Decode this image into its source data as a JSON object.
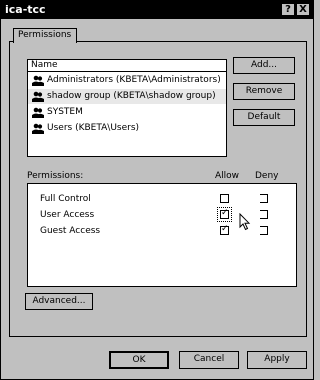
{
  "window": {
    "title": "ica-tcc",
    "help_glyph": "?",
    "close_glyph": "X"
  },
  "tabs": [
    {
      "label": "Permissions"
    }
  ],
  "accounts": {
    "header": "Name",
    "items": [
      {
        "label": "Administrators (KBETA\\Administrators)",
        "icon": "group-icon"
      },
      {
        "label": "shadow group (KBETA\\shadow group)",
        "icon": "group-icon",
        "selected": true
      },
      {
        "label": "SYSTEM",
        "icon": "group-icon"
      },
      {
        "label": "Users (KBETA\\Users)",
        "icon": "group-icon"
      }
    ]
  },
  "side_buttons": {
    "add": "Add...",
    "remove": "Remove",
    "default": "Default"
  },
  "permissions": {
    "header": "Permissions:",
    "allow_label": "Allow",
    "deny_label": "Deny",
    "rows": [
      {
        "label": "Full Control",
        "allow": false,
        "deny": false
      },
      {
        "label": "User Access",
        "allow": true,
        "deny": false
      },
      {
        "label": "Guest Access",
        "allow": true,
        "deny": false
      }
    ]
  },
  "advanced_button": "Advanced...",
  "dialog_buttons": {
    "ok": "OK",
    "cancel": "Cancel",
    "apply": "Apply"
  },
  "colors": {
    "selected_row_bg": "#e8e8e8",
    "dialog_bg": "#c0c0c0"
  }
}
